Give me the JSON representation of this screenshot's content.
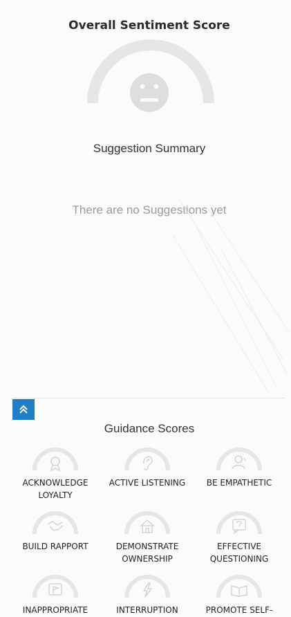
{
  "sentiment": {
    "title": "Overall Sentiment Score"
  },
  "suggestions": {
    "title": "Suggestion Summary",
    "empty_message": "There are no Suggestions yet"
  },
  "guidance": {
    "title": "Guidance Scores",
    "items": [
      {
        "label": "ACKNOWLEDGE LOYALTY",
        "icon": "rosette-icon"
      },
      {
        "label": "ACTIVE LISTENING",
        "icon": "ear-icon"
      },
      {
        "label": "BE EMPATHETIC",
        "icon": "person-icon"
      },
      {
        "label": "BUILD RAPPORT",
        "icon": "handshake-icon"
      },
      {
        "label": "DEMONSTRATE OWNERSHIP",
        "icon": "home-icon"
      },
      {
        "label": "EFFECTIVE QUESTIONING",
        "icon": "question-bubble-icon"
      },
      {
        "label": "INAPPROPRIATE ACTION",
        "icon": "flag-icon"
      },
      {
        "label": "INTERRUPTION",
        "icon": "lightning-icon"
      },
      {
        "label": "PROMOTE SELF-SERVICE",
        "icon": "book-icon"
      }
    ]
  },
  "colors": {
    "gauge_track": "#e6e6e6",
    "face": "#dedede",
    "accent": "#1f7fc6",
    "muted_text": "#9b9b9b"
  }
}
